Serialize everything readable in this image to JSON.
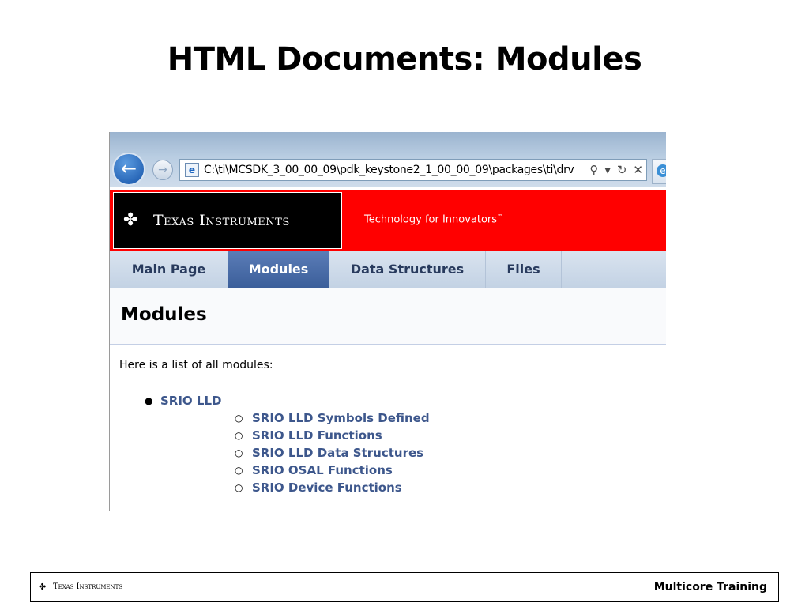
{
  "slide": {
    "title": "HTML Documents: Modules"
  },
  "browser": {
    "address": "C:\\ti\\MCSDK_3_00_00_09\\pdk_keystone2_1_00_00_09\\packages\\ti\\drv",
    "icons": {
      "back": "back-arrow-icon",
      "forward": "forward-arrow-icon",
      "page": "ie-page-icon",
      "search": "search-icon",
      "dropdown": "dropdown-arrow-icon",
      "refresh": "refresh-icon",
      "stop": "close-icon"
    }
  },
  "banner": {
    "brand": "Texas Instruments",
    "tagline": "Technology for Innovators",
    "tagline_mark": "™",
    "colors": {
      "banner": "#ff0000",
      "logo_bg": "#000000"
    }
  },
  "nav": {
    "tabs": [
      {
        "label": "Main Page",
        "active": false
      },
      {
        "label": "Modules",
        "active": true
      },
      {
        "label": "Data Structures",
        "active": false
      },
      {
        "label": "Files",
        "active": false
      }
    ]
  },
  "page": {
    "heading": "Modules",
    "intro": "Here is a list of all modules:",
    "modules": [
      {
        "label": "SRIO LLD",
        "children": [
          "SRIO LLD Symbols Defined",
          "SRIO LLD Functions",
          "SRIO LLD Data Structures",
          "SRIO OSAL Functions",
          "SRIO Device Functions"
        ]
      }
    ],
    "colors": {
      "link": "#3d578c",
      "active_tab": "#3b5e9a"
    }
  },
  "footer": {
    "brand": "Texas Instruments",
    "right_text": "Multicore Training"
  }
}
